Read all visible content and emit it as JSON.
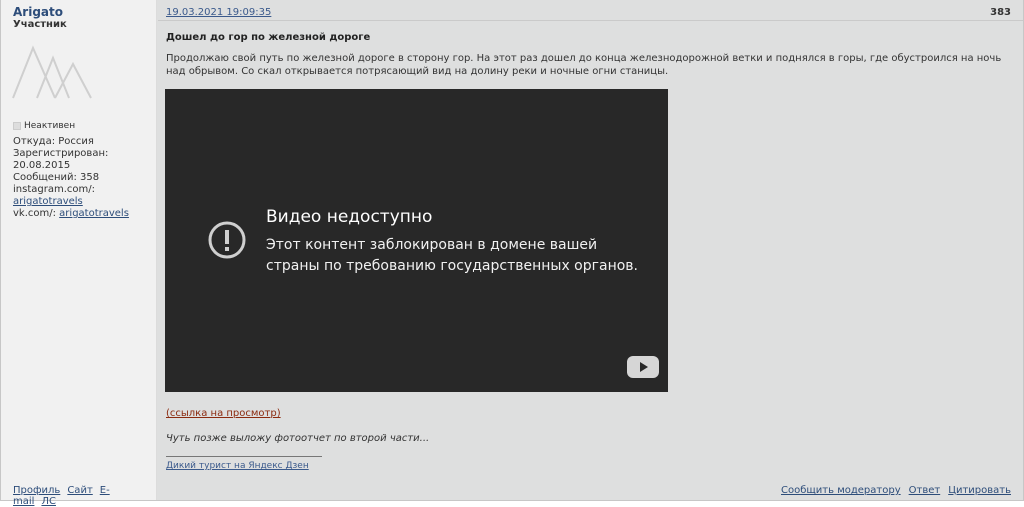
{
  "post": {
    "date": "19.03.2021 19:09:35",
    "number": "383",
    "title": "Дошел до гор по железной дороге",
    "body": "Продолжаю свой путь по железной дороге в сторону гор. На этот раз дошел до конца железнодорожной ветки и поднялся в горы, где обустроился на ночь над обрывом. Со скал открывается потрясающий вид на долину реки и ночные огни станицы.",
    "view_link": "(ссылка на просмотр)",
    "later_note": "Чуть позже выложу фотоотчет по второй части...",
    "signature_link": "Дикий турист на Яндекс Дзен"
  },
  "video": {
    "title": "Видео недоступно",
    "message": "Этот контент заблокирован в домене вашей страны по требованию государственных органов.",
    "icon": "alert-circle-icon",
    "logo": "youtube-logo-icon"
  },
  "user": {
    "name": "Arigato",
    "title": "Участник",
    "status": "Неактивен",
    "from": "Откуда: Россия",
    "registered_label": "Зарегистрирован:",
    "registered_date": "20.08.2015",
    "posts": "Сообщений: 358",
    "instagram_label": "instagram.com/:",
    "instagram_handle": "arigatotravels",
    "vk_label": "vk.com/:",
    "vk_handle": "arigatotravels"
  },
  "user_links": {
    "profile": "Профиль",
    "site": "Сайт",
    "email": "E-mail",
    "pm": "ЛС"
  },
  "actions": {
    "report": "Сообщить модератору",
    "reply": "Ответ",
    "quote": "Цитировать"
  },
  "colors": {
    "link": "#2d4d7a",
    "view_link": "#8b2a0f",
    "video_bg": "#282828"
  }
}
